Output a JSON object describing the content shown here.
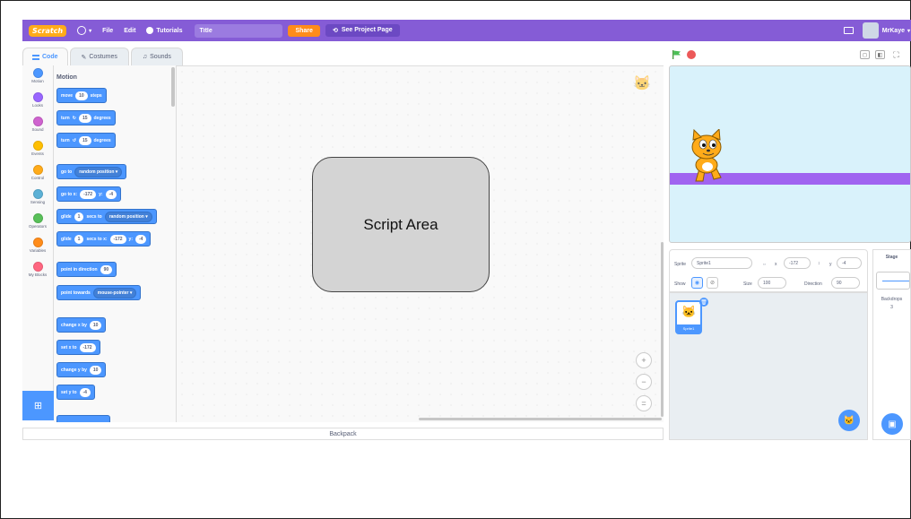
{
  "menubar": {
    "logo": "Scratch",
    "file": "File",
    "edit": "Edit",
    "tutorials": "Tutorials",
    "project_title": "Title",
    "share": "Share",
    "see_project_page": "See Project Page",
    "username": "MrKaye"
  },
  "tabs": {
    "code": "Code",
    "costumes": "Costumes",
    "sounds": "Sounds"
  },
  "categories": [
    {
      "label": "Motion",
      "color": "#4c97ff"
    },
    {
      "label": "Looks",
      "color": "#9966ff"
    },
    {
      "label": "Sound",
      "color": "#cf63cf"
    },
    {
      "label": "Events",
      "color": "#ffbf00"
    },
    {
      "label": "Control",
      "color": "#ffab19"
    },
    {
      "label": "Sensing",
      "color": "#5cb1d6"
    },
    {
      "label": "Operators",
      "color": "#59c059"
    },
    {
      "label": "Variables",
      "color": "#ff8c1a"
    },
    {
      "label": "My Blocks",
      "color": "#ff6680"
    }
  ],
  "palette": {
    "heading": "Motion",
    "blocks": {
      "move": {
        "a": "move",
        "v": "10",
        "b": "steps"
      },
      "turn_right": {
        "a": "turn",
        "arrow": "↻",
        "v": "15",
        "b": "degrees"
      },
      "turn_left": {
        "a": "turn",
        "arrow": "↺",
        "v": "15",
        "b": "degrees"
      },
      "goto": {
        "a": "go to",
        "dd": "random position ▾"
      },
      "goto_xy": {
        "a": "go to x:",
        "x": "-172",
        "b": "y:",
        "y": "-4"
      },
      "glide_to": {
        "a": "glide",
        "v": "1",
        "b": "secs to",
        "dd": "random position ▾"
      },
      "glide_xy": {
        "a": "glide",
        "v": "1",
        "b": "secs to x:",
        "x": "-172",
        "c": "y:",
        "y": "-4"
      },
      "point_dir": {
        "a": "point in direction",
        "v": "90"
      },
      "point_towards": {
        "a": "point towards",
        "dd": "mouse-pointer ▾"
      },
      "change_x": {
        "a": "change x by",
        "v": "10"
      },
      "set_x": {
        "a": "set x to",
        "v": "-172"
      },
      "change_y": {
        "a": "change y by",
        "v": "10"
      },
      "set_y": {
        "a": "set y to",
        "v": "-4"
      }
    }
  },
  "script_area": {
    "callout": "Script Area"
  },
  "backpack": "Backpack",
  "sprite_info": {
    "sprite_label": "Sprite",
    "sprite_name": "Sprite1",
    "x_label": "x",
    "x_value": "-172",
    "y_label": "y",
    "y_value": "-4",
    "show_label": "Show",
    "size_label": "Size",
    "size_value": "100",
    "direction_label": "Direction",
    "direction_value": "90"
  },
  "sprite_list": {
    "sprite1": "Sprite1"
  },
  "stage_panel": {
    "heading": "Stage",
    "backdrops_label": "Backdrops",
    "backdrops_count": "3"
  }
}
